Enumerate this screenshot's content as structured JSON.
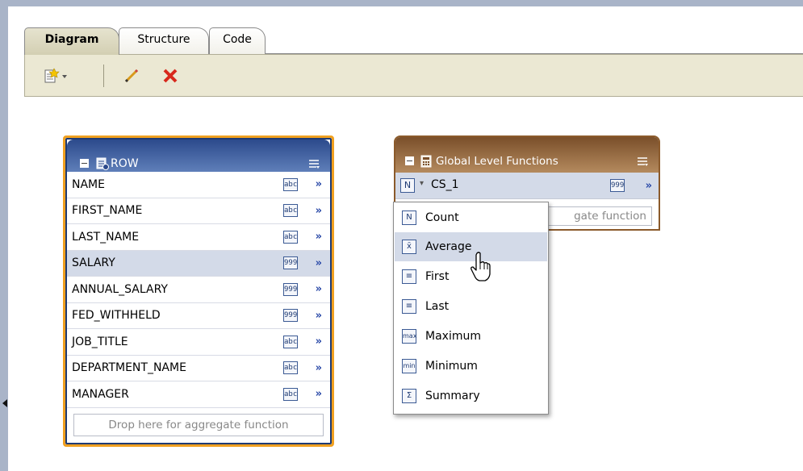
{
  "tabs": [
    {
      "label": "Diagram",
      "active": true
    },
    {
      "label": "Structure",
      "active": false
    },
    {
      "label": "Code",
      "active": false
    }
  ],
  "toolbar": {
    "new_icon": "new-element-icon",
    "edit_icon": "pencil-icon",
    "delete_icon": "delete-x-icon"
  },
  "row_panel": {
    "title": "ROW",
    "columns": [
      {
        "name": "NAME",
        "type": "abc"
      },
      {
        "name": "FIRST_NAME",
        "type": "abc"
      },
      {
        "name": "LAST_NAME",
        "type": "abc"
      },
      {
        "name": "SALARY",
        "type": "999",
        "selected": true
      },
      {
        "name": "ANNUAL_SALARY",
        "type": "999"
      },
      {
        "name": "FED_WITHHELD",
        "type": "999"
      },
      {
        "name": "JOB_TITLE",
        "type": "abc"
      },
      {
        "name": "DEPARTMENT_NAME",
        "type": "abc"
      },
      {
        "name": "MANAGER",
        "type": "abc"
      }
    ],
    "drop_text": "Drop here for aggregate function",
    "chevron": "»"
  },
  "glf_panel": {
    "title": "Global Level Functions",
    "item_type": "N",
    "item_name": "CS_1",
    "item_badge": "999",
    "chevron": "»",
    "drop_text_visible": "gate function"
  },
  "function_menu": {
    "items": [
      {
        "icon": "N",
        "label": "Count"
      },
      {
        "icon": "x̄",
        "label": "Average",
        "hover": true
      },
      {
        "icon": "≡",
        "label": "First"
      },
      {
        "icon": "≡",
        "label": "Last"
      },
      {
        "icon": "max",
        "label": "Maximum"
      },
      {
        "icon": "min",
        "label": "Minimum"
      },
      {
        "icon": "Σ",
        "label": "Summary"
      }
    ]
  },
  "colors": {
    "row_header": "#2c4a8c",
    "glf_header": "#7a4f2a",
    "selection": "#d3dae8",
    "focus_border": "#f0a020"
  }
}
